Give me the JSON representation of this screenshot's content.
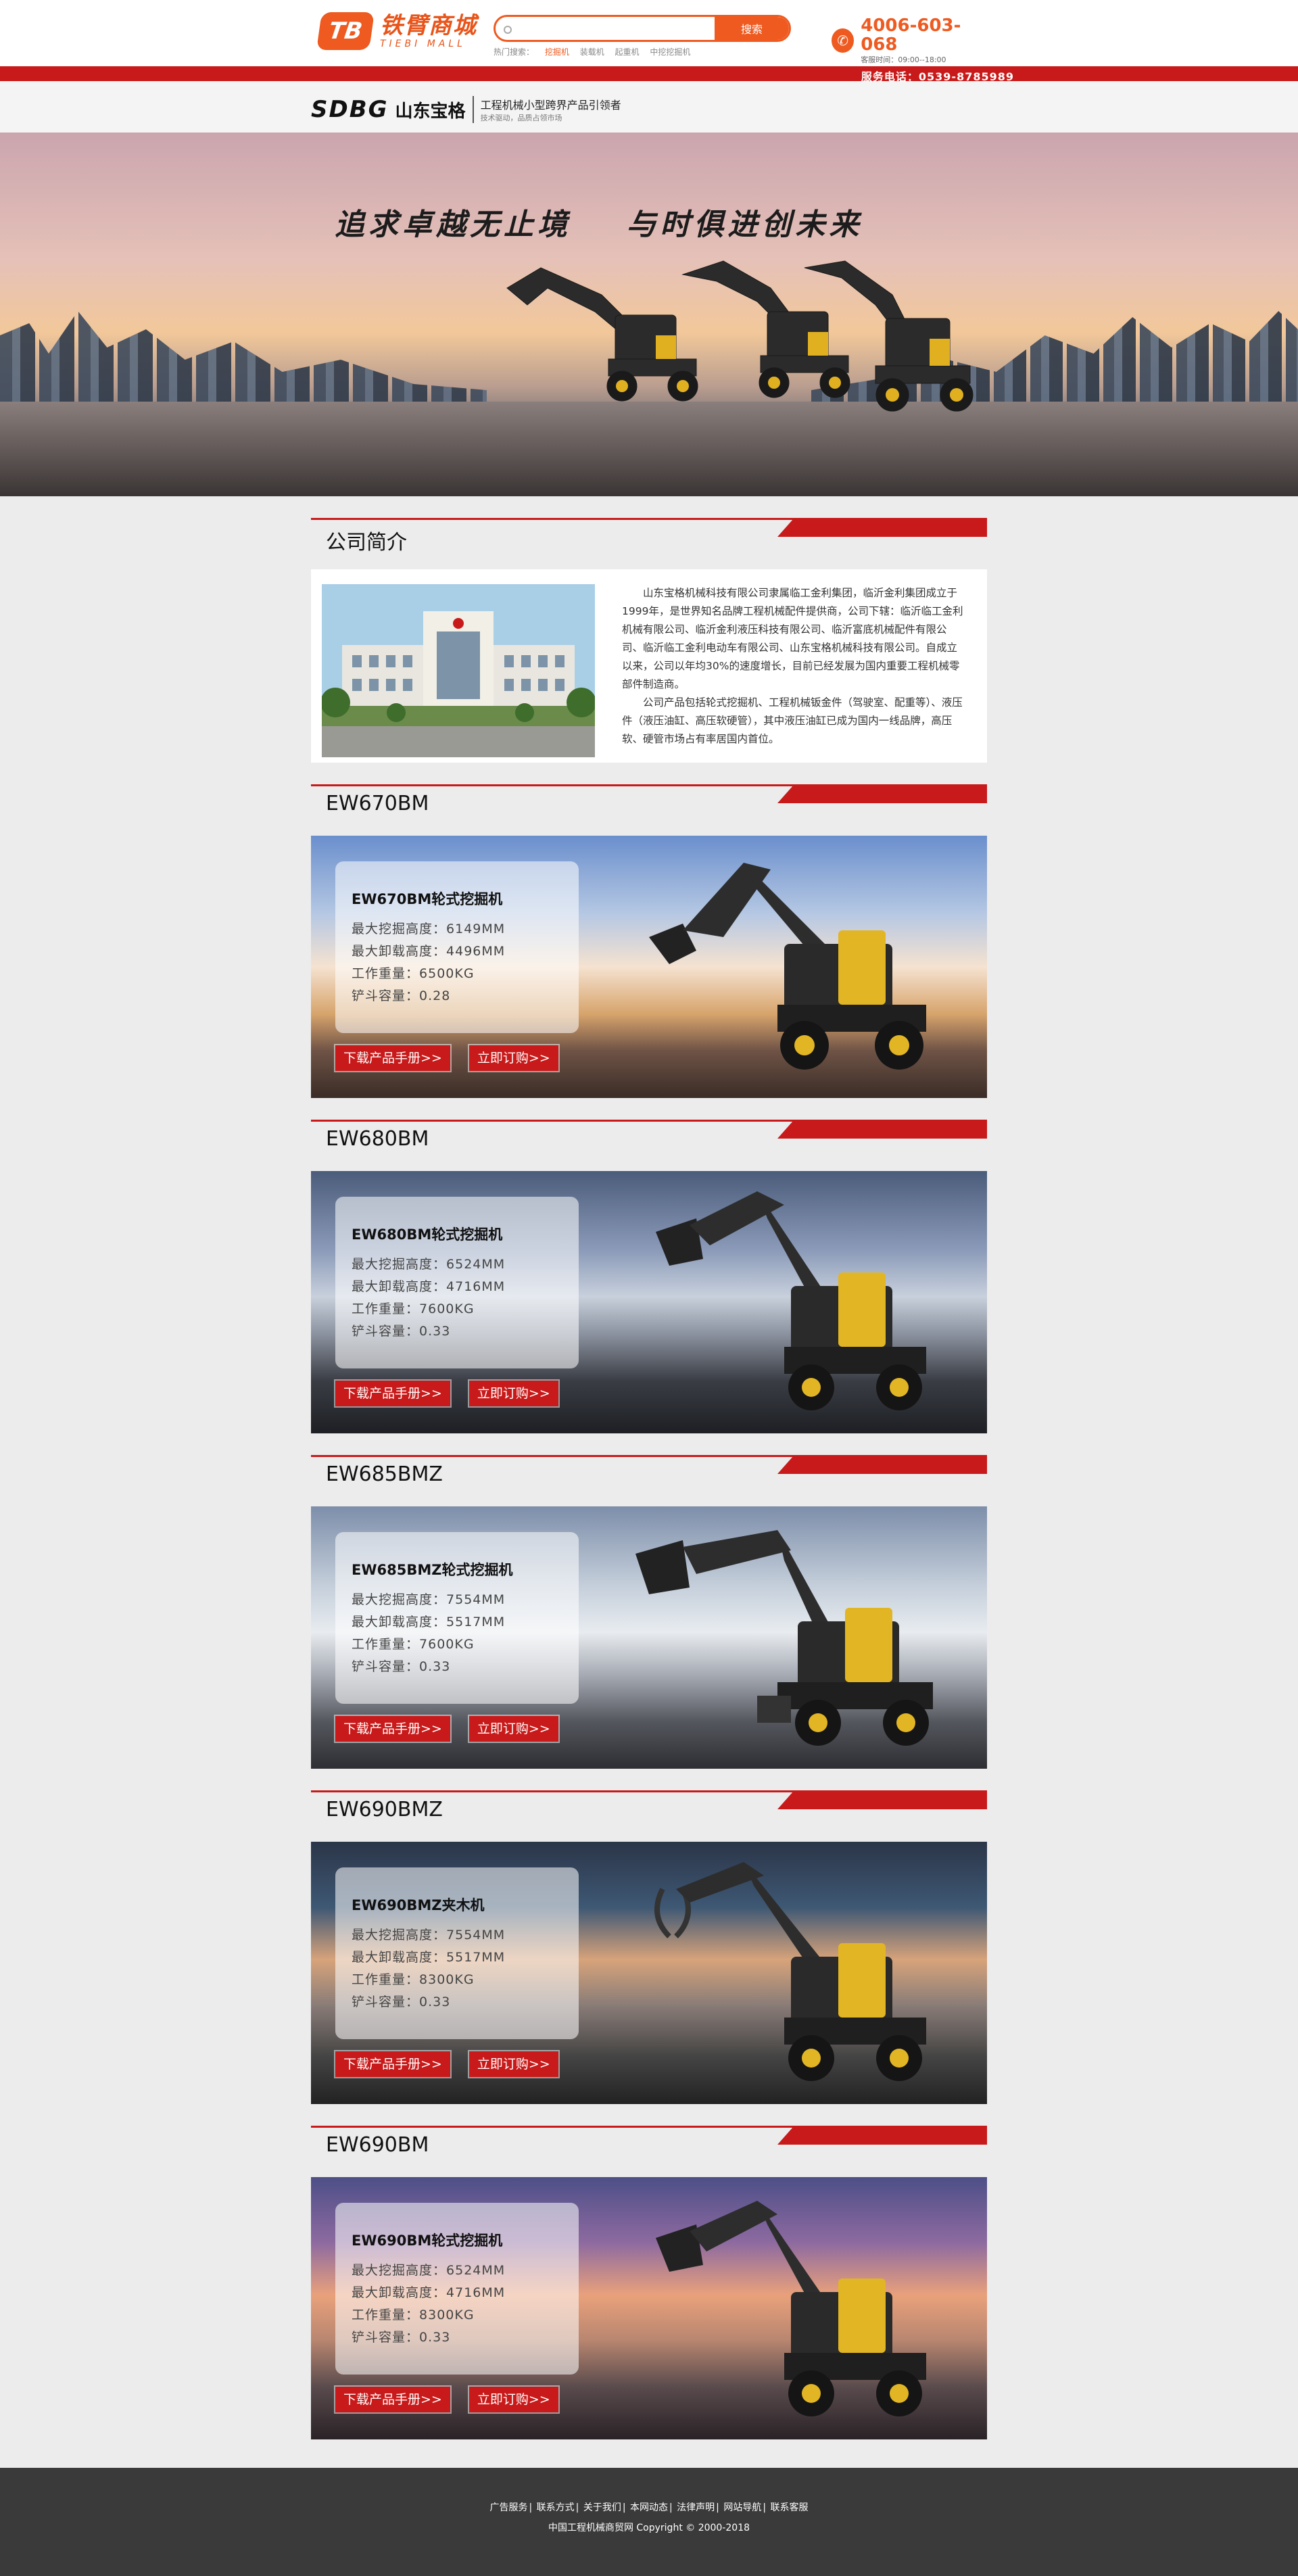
{
  "header": {
    "logo_mark": "TB",
    "logo_cn": "铁臂商城",
    "logo_en": "TIEBI MALL",
    "search_placeholder": "",
    "search_button": "搜索",
    "hot_label": "热门搜索：",
    "hot_items": [
      "挖掘机",
      "装载机",
      "起重机",
      "中挖挖掘机"
    ],
    "phone_number": "4006-603-068",
    "phone_hours": "客服时间：09:00--18:00",
    "accent_color": "#ee5a20"
  },
  "service_bar": {
    "text": "服务电话：0539-8785989"
  },
  "brand": {
    "logo": "SDBG",
    "name_cn": "山东宝格",
    "slogan_1": "工程机械小型跨界产品引领者",
    "slogan_2": "技术驱动，品质占领市场"
  },
  "hero": {
    "slogan_1": "追求卓越无止境",
    "slogan_2": "与时俱进创未来"
  },
  "intro": {
    "title": "公司简介",
    "para_1": "山东宝格机械科技有限公司隶属临工金利集团，临沂金利集团成立于1999年，是世界知名品牌工程机械配件提供商，公司下辖：临沂临工金利机械有限公司、临沂金利液压科技有限公司、临沂富底机械配件有限公司、临沂临工金利电动车有限公司、山东宝格机械科技有限公司。自成立以来，公司以年均30%的速度增长，目前已经发展为国内重要工程机械零部件制造商。",
    "para_2": "公司产品包括轮式挖掘机、工程机械钣金件（驾驶室、配重等）、液压件（液压油缸、高压软硬管），其中液压油缸已成为国内一线品牌，高压软、硬管市场占有率居国内首位。"
  },
  "labels": {
    "spec_dig_height": "最大挖掘高度：",
    "spec_dump_height": "最大卸载高度：",
    "spec_weight": "工作重量：",
    "spec_bucket": "铲斗容量：",
    "download_btn": "下载产品手册>>",
    "order_btn": "立即订购>>"
  },
  "products": [
    {
      "model": "EW670BM",
      "name": "EW670BM轮式挖掘机",
      "dig_height": "6149MM",
      "dump_height": "4496MM",
      "weight": "6500KG",
      "bucket": "0.28"
    },
    {
      "model": "EW680BM",
      "name": "EW680BM轮式挖掘机",
      "dig_height": "6524MM",
      "dump_height": "4716MM",
      "weight": "7600KG",
      "bucket": "0.33"
    },
    {
      "model": "EW685BMZ",
      "name": "EW685BMZ轮式挖掘机",
      "dig_height": "7554MM",
      "dump_height": "5517MM",
      "weight": "7600KG",
      "bucket": "0.33"
    },
    {
      "model": "EW690BMZ",
      "name": "EW690BMZ夹木机",
      "dig_height": "7554MM",
      "dump_height": "5517MM",
      "weight": "8300KG",
      "bucket": "0.33"
    },
    {
      "model": "EW690BM",
      "name": "EW690BM轮式挖掘机",
      "dig_height": "6524MM",
      "dump_height": "4716MM",
      "weight": "8300KG",
      "bucket": "0.33"
    }
  ],
  "footer": {
    "links": [
      "广告服务",
      "联系方式",
      "关于我们",
      "本网动态",
      "法律声明",
      "网站导航",
      "联系客服"
    ],
    "copyright": "中国工程机械商贸网 Copyright © 2000-2018"
  }
}
